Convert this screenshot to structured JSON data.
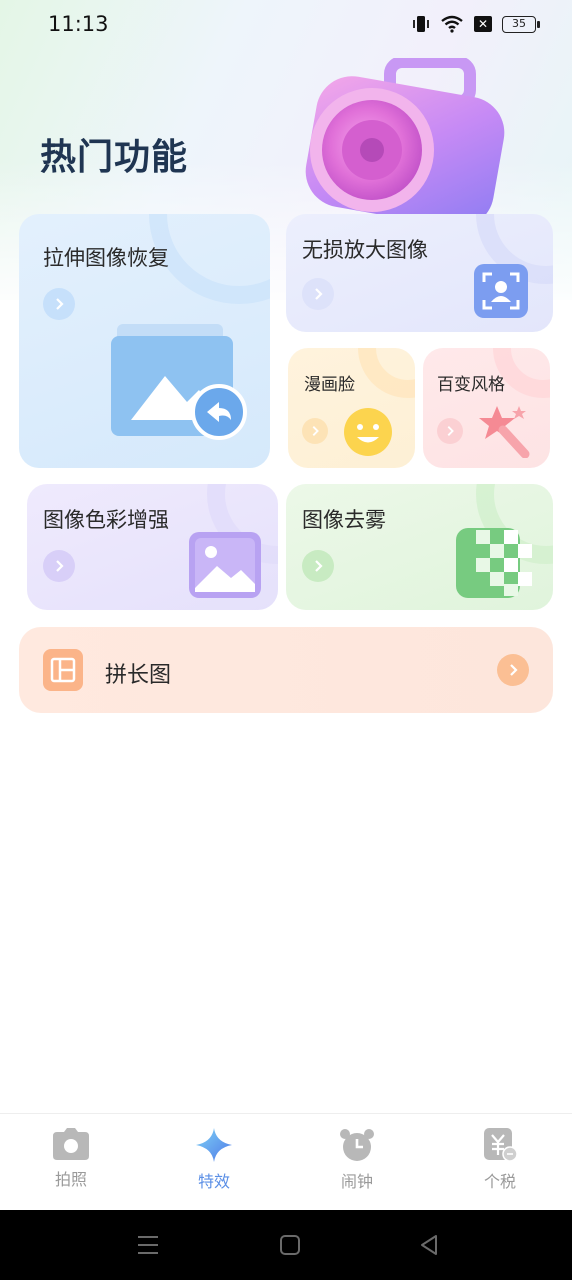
{
  "status": {
    "time": "11:13",
    "battery": "35"
  },
  "header": {
    "title": "热门功能"
  },
  "cards": {
    "stretch": {
      "title": "拉伸图像恢复"
    },
    "lossless": {
      "title": "无损放大图像"
    },
    "cartoon": {
      "title": "漫画脸"
    },
    "style": {
      "title": "百变风格"
    },
    "color": {
      "title": "图像色彩增强"
    },
    "dehaze": {
      "title": "图像去雾"
    },
    "long": {
      "title": "拼长图"
    }
  },
  "tabs": [
    {
      "label": "拍照",
      "icon": "camera-icon"
    },
    {
      "label": "特效",
      "icon": "sparkle-icon",
      "active": true
    },
    {
      "label": "闹钟",
      "icon": "alarm-icon"
    },
    {
      "label": "个税",
      "icon": "tax-icon"
    }
  ],
  "colors": {
    "accent": "#5b8fe6",
    "title": "#1f3552"
  }
}
